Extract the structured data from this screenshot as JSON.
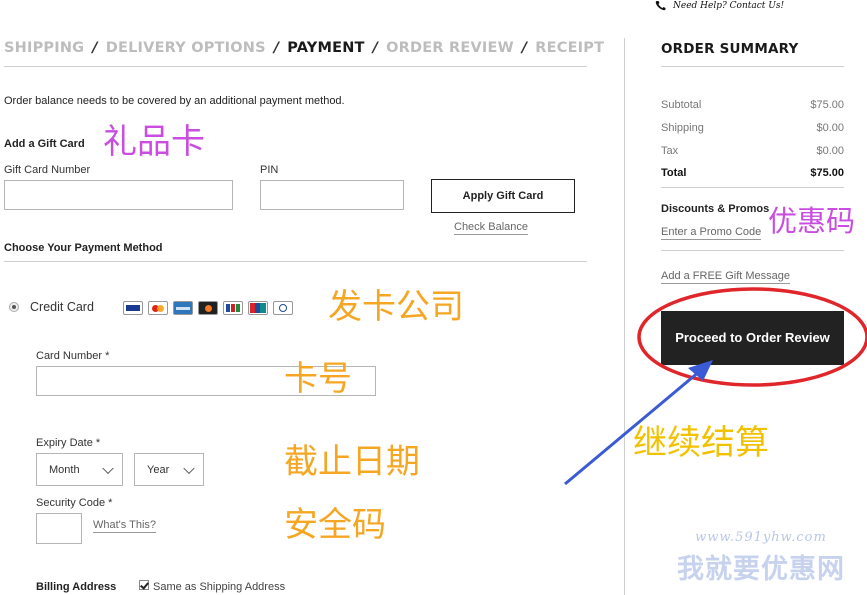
{
  "help": {
    "text": "Need Help? Contact Us!",
    "icon": "phone-icon"
  },
  "steps": {
    "shipping": "SHIPPING",
    "delivery": "DELIVERY OPTIONS",
    "payment": "PAYMENT",
    "review": "ORDER REVIEW",
    "receipt": "RECEIPT",
    "separator": "/"
  },
  "payment": {
    "notice": "Order balance needs to be covered by an additional payment method.",
    "gift_card": {
      "heading": "Add a Gift Card",
      "number_label": "Gift Card Number",
      "pin_label": "PIN",
      "apply_label": "Apply Gift Card",
      "check_balance": "Check Balance"
    },
    "choose_heading": "Choose Your Payment Method",
    "credit_card_label": "Credit Card",
    "card_brands": [
      "visa",
      "mastercard",
      "amex",
      "discover",
      "jcb",
      "unionpay",
      "diners"
    ],
    "card_number_label": "Card Number *",
    "expiry_label": "Expiry Date *",
    "month_value": "Month",
    "year_value": "Year",
    "security_label": "Security Code *",
    "whats_this": "What's This?",
    "billing_label": "Billing Address",
    "same_as_shipping": "Same as Shipping Address"
  },
  "summary": {
    "title": "ORDER SUMMARY",
    "rows": [
      {
        "label": "Subtotal",
        "value": "$75.00"
      },
      {
        "label": "Shipping",
        "value": "$0.00"
      },
      {
        "label": "Tax",
        "value": "$0.00"
      },
      {
        "label": "Total",
        "value": "$75.00"
      }
    ],
    "discounts_heading": "Discounts & Promos",
    "promo_link": "Enter a Promo Code",
    "gift_message_link": "Add a FREE Gift Message",
    "proceed_label": "Proceed to Order Review"
  },
  "annotations": {
    "gift_card": "礼品卡",
    "promo": "优惠码",
    "issuer": "发卡公司",
    "card_number": "卡号",
    "expiry": "截止日期",
    "security": "安全码",
    "continue": "继续结算",
    "color_purple": "#c94ee0",
    "color_orange": "#f5a623",
    "color_yellow": "#f2c200",
    "color_red": "#e0262b",
    "color_arrow": "#3b5bd6"
  },
  "watermark": {
    "url": "www.591yhw.com",
    "name": "我就要优惠网"
  }
}
